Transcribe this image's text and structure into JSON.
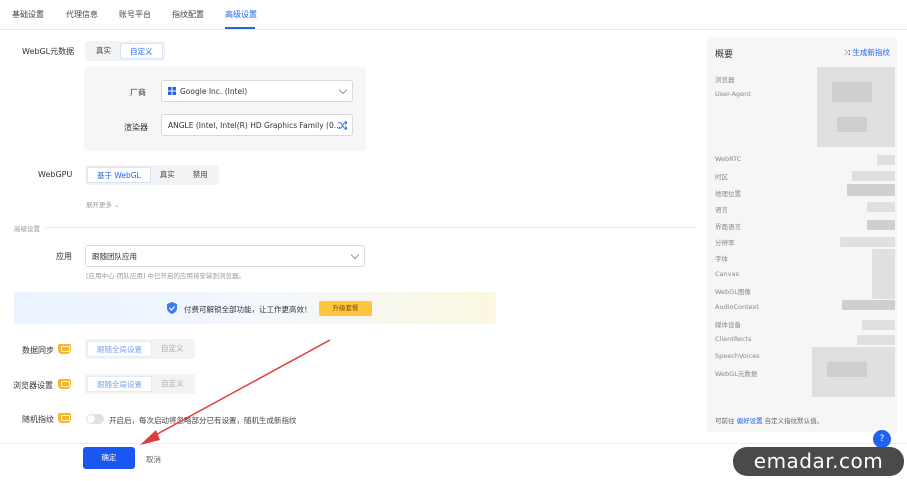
{
  "tabs": [
    "基础设置",
    "代理信息",
    "账号平台",
    "指纹配置",
    "高级设置"
  ],
  "active_tab_index": 4,
  "accent": "#1f63f0",
  "webgl_meta": {
    "label": "WebGL元数据",
    "options": [
      "真实",
      "自定义"
    ],
    "selected": "自定义",
    "vendor_label": "厂商",
    "vendor_value": "Google Inc. (Intel)",
    "vendor_icon": "windows-icon",
    "renderer_label": "渲染器",
    "renderer_value": "ANGLE (Intel, Intel(R) HD Graphics Family (0...",
    "renderer_icon": "shuffle-icon"
  },
  "webgpu": {
    "label": "WebGPU",
    "options": [
      "基于 WebGL",
      "真实",
      "禁用"
    ],
    "selected": "基于 WebGL",
    "expand_label": "展开更多"
  },
  "advanced": {
    "section_label": "高级设置",
    "app_label": "应用",
    "app_value": "跟随团队应用",
    "app_hint": "[应用中心-团队应用] 中已开启的应用将安装到浏览器。"
  },
  "promo": {
    "text": "付费可解锁全部功能，让工作更高效！",
    "button": "升级套餐"
  },
  "data_sync": {
    "label": "数据同步",
    "options": [
      "跟随全局设置",
      "自定义"
    ],
    "selected": "跟随全局设置"
  },
  "browser_settings": {
    "label": "浏览器设置",
    "options": [
      "跟随全局设置",
      "自定义"
    ],
    "selected": "跟随全局设置"
  },
  "random_fp": {
    "label": "随机指纹",
    "description": "开启后，每次启动将忽略部分已有设置，随机生成新指纹"
  },
  "footer": {
    "confirm": "确定",
    "cancel": "取消"
  },
  "summary": {
    "title": "概要",
    "generate": "生成新指纹",
    "rows": [
      "浏览器",
      "User-Agent",
      "WebRTC",
      "时区",
      "地理位置",
      "语言",
      "界面语言",
      "分辨率",
      "字体",
      "Canvas",
      "WebGL图像",
      "AudioContext",
      "媒体设备",
      "ClientRects",
      "SpeechVoices",
      "WebGL元数据"
    ],
    "footer_prefix": "可前往",
    "footer_link": "偏好设置",
    "footer_suffix": "自定义指纹默认值。"
  },
  "watermark": "emadar.com"
}
